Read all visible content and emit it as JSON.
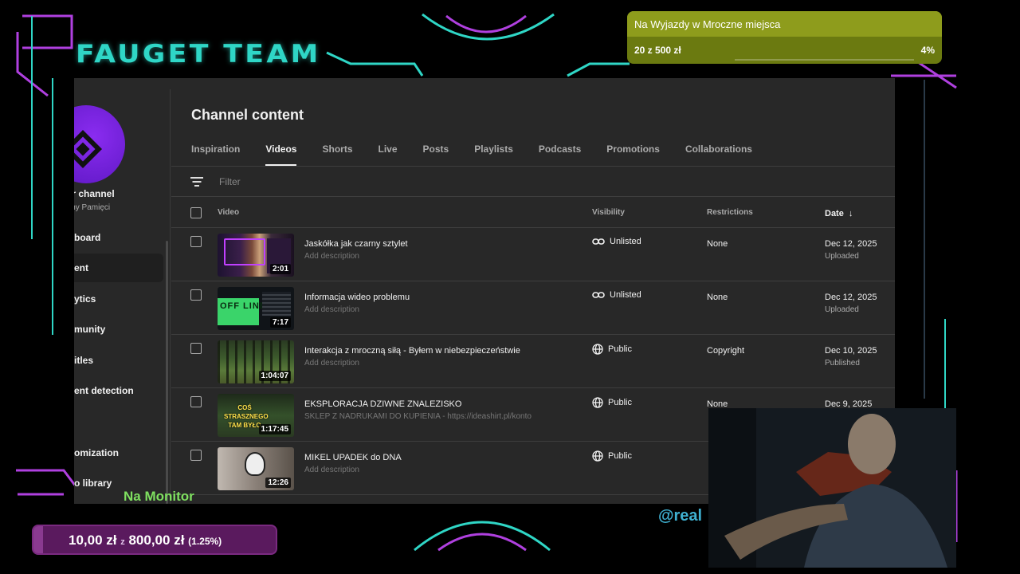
{
  "overlay": {
    "team_logo": "FAUGET TEAM",
    "monitor_label": "Na Monitor",
    "handle": "@real"
  },
  "goal_top": {
    "title": "Na Wyjazdy w Mroczne miejsca",
    "amount": "20  z  500  zł",
    "percent": "4%",
    "progress": 0.04
  },
  "goal_bottom": {
    "raised": "10,00 zł",
    "sep": "z",
    "target": "800,00 zł",
    "percent": "(1.25%)",
    "progress": 0.0125
  },
  "sidebar": {
    "channel_name": "ur channel",
    "channel_sub": "iny Pamięci",
    "items": [
      {
        "label": "board"
      },
      {
        "label": "ent",
        "active": true
      },
      {
        "label": "ytics"
      },
      {
        "label": "munity"
      },
      {
        "label": "itles"
      },
      {
        "label": "ent detection"
      },
      {
        "label": "omization"
      },
      {
        "label": "o library"
      }
    ]
  },
  "main": {
    "title": "Channel content",
    "tabs": [
      {
        "label": "Inspiration"
      },
      {
        "label": "Videos",
        "active": true
      },
      {
        "label": "Shorts"
      },
      {
        "label": "Live"
      },
      {
        "label": "Posts"
      },
      {
        "label": "Playlists"
      },
      {
        "label": "Podcasts"
      },
      {
        "label": "Promotions"
      },
      {
        "label": "Collaborations"
      }
    ],
    "filter_placeholder": "Filter",
    "columns": {
      "video": "Video",
      "visibility": "Visibility",
      "restrictions": "Restrictions",
      "date": "Date"
    },
    "rows": [
      {
        "title": "Jaskółka jak czarny sztylet",
        "desc": "Add description",
        "duration": "2:01",
        "visibility": "Unlisted",
        "vis_icon": "link-icon",
        "restrictions": "None",
        "date": "Dec 12, 2025",
        "date_status": "Uploaded"
      },
      {
        "title": "Informacja wideo problemu",
        "desc": "Add description",
        "duration": "7:17",
        "visibility": "Unlisted",
        "vis_icon": "link-icon",
        "restrictions": "None",
        "date": "Dec 12, 2025",
        "date_status": "Uploaded"
      },
      {
        "title": "Interakcja z mroczną siłą - Byłem w niebezpieczeństwie",
        "desc": "Add description",
        "duration": "1:04:07",
        "visibility": "Public",
        "vis_icon": "globe-icon",
        "restrictions": "Copyright",
        "date": "Dec 10, 2025",
        "date_status": "Published"
      },
      {
        "title": "EKSPLORACJA DZIWNE ZNALEZISKO",
        "desc": "SKLEP Z NADRUKAMI DO KUPIENIA - https://ideashirt.pl/konto",
        "duration": "1:17:45",
        "visibility": "Public",
        "vis_icon": "globe-icon",
        "restrictions": "None",
        "date": "Dec 9, 2025",
        "date_status": ""
      },
      {
        "title": "MIKEL UPADEK do DNA",
        "desc": "Add description",
        "duration": "12:26",
        "visibility": "Public",
        "vis_icon": "globe-icon",
        "restrictions": "",
        "date": "",
        "date_status": ""
      }
    ],
    "thumb_text_row4": "COŚ STRASZNEGO TAM BYŁO",
    "thumb_text_row2": "OFF LINE"
  },
  "colors": {
    "accent_teal": "#2fd6c6",
    "neon_purple": "#b040e0",
    "studio_bg": "#282828",
    "goal_top": "#8e9c1c",
    "goal_bottom": "#5a1a5e"
  }
}
